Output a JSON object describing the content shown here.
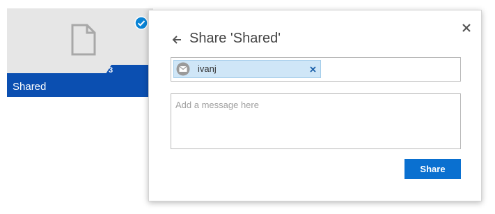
{
  "tile": {
    "label": "Shared",
    "count": "3",
    "icon": "document-icon",
    "selected": true,
    "colors": {
      "background": "#e6e6e6",
      "footer": "#0b4fb1",
      "check": "#0a84d6"
    }
  },
  "dialog": {
    "title": "Share 'Shared'",
    "back_icon": "arrow-left-icon",
    "close_icon": "close-icon",
    "recipients": [
      {
        "name": "ivanj",
        "icon": "mail-icon"
      }
    ],
    "message": {
      "value": "",
      "placeholder": "Add a message here"
    },
    "share_label": "Share",
    "colors": {
      "accent": "#0a70d0",
      "chip": "#cfe6f7",
      "chip_border": "#a5cdea"
    }
  }
}
